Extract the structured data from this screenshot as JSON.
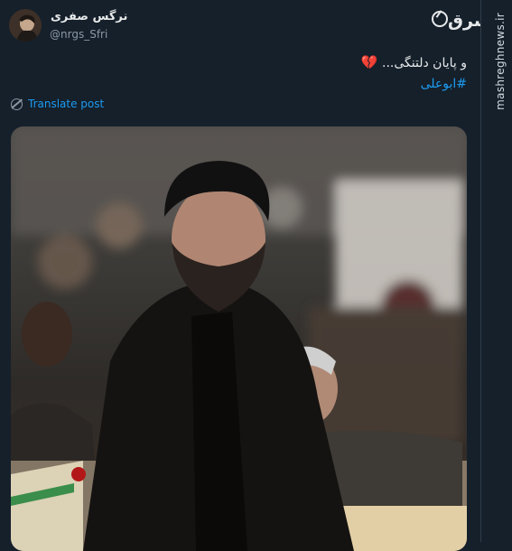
{
  "user": {
    "display_name": "نرگس صفری",
    "handle": "@nrgs_Sfri"
  },
  "brand": {
    "logo_text": "مشرق"
  },
  "tweet": {
    "text": "و پایان دلتنگی...",
    "emoji": "💔",
    "hashtag": "#ابوعلی"
  },
  "translate_label": "Translate post",
  "side_watermark": "mashreghnews.ir"
}
